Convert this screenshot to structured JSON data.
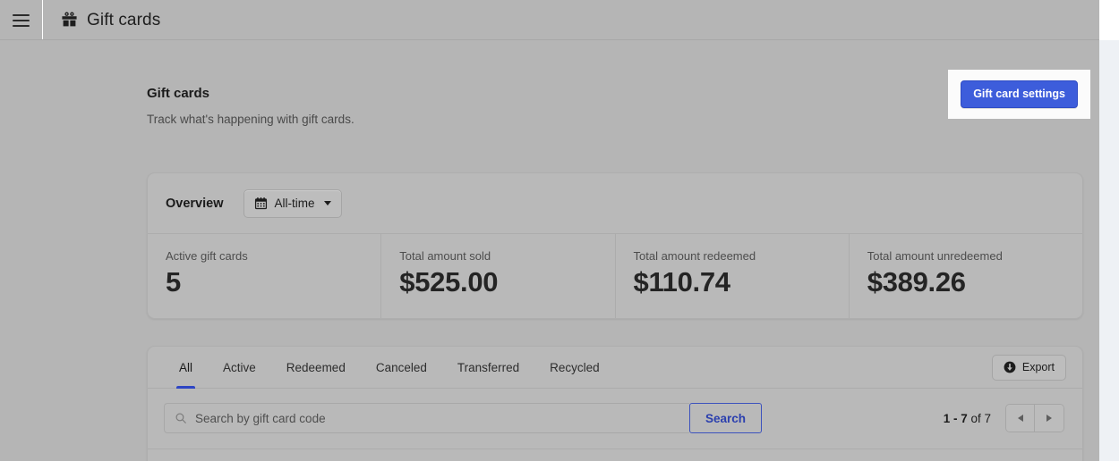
{
  "topbar": {
    "menu_icon": "hamburger-icon",
    "app_icon": "gift-icon",
    "title": "Gift cards"
  },
  "page": {
    "title": "Gift cards",
    "subtitle": "Track what's happening with gift cards.",
    "settings_button": "Gift card settings"
  },
  "overview": {
    "title": "Overview",
    "range_icon": "calendar-icon",
    "range_label": "All-time",
    "metrics": [
      {
        "label": "Active gift cards",
        "value": "5"
      },
      {
        "label": "Total amount sold",
        "value": "$525.00"
      },
      {
        "label": "Total amount redeemed",
        "value": "$110.74"
      },
      {
        "label": "Total amount unredeemed",
        "value": "$389.26"
      }
    ]
  },
  "list": {
    "tabs": [
      {
        "label": "All",
        "active": true
      },
      {
        "label": "Active",
        "active": false
      },
      {
        "label": "Redeemed",
        "active": false
      },
      {
        "label": "Canceled",
        "active": false
      },
      {
        "label": "Transferred",
        "active": false
      },
      {
        "label": "Recycled",
        "active": false
      }
    ],
    "export_label": "Export",
    "export_icon": "export-circle-icon",
    "search": {
      "icon": "search-icon",
      "placeholder": "Search by gift card code",
      "value": "",
      "button_label": "Search"
    },
    "pagination": {
      "range": "1 - 7",
      "of": " of ",
      "total": "7",
      "prev_icon": "chevron-left-icon",
      "next_icon": "chevron-right-icon"
    }
  },
  "colors": {
    "accent_blue": "#3d5ddb",
    "tab_underline": "#2e45c4",
    "search_button_text": "#2b3fae",
    "page_background": "#b5b5b5",
    "card_background": "#b9b9b9",
    "right_strip": "#eef1f5"
  }
}
